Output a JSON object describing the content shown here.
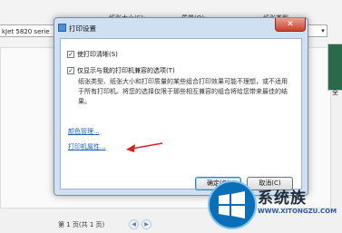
{
  "background": {
    "printer_select": "kJet 5820 serie",
    "headers": [
      "纸张大小(S):",
      "质量(Q):",
      "纸张类型"
    ],
    "page_nav_text": "第 1 页(共 1 页)",
    "thumb_label": "全"
  },
  "dialog": {
    "title": "打印设置",
    "close_symbol": "✕",
    "checkbox1_label": "使打印清晰(S)",
    "checkbox2_label": "仅显示与我的打印机兼容的选项(T)",
    "description": "纸张类型、纸张大小和打印质量的某些组合打印效果可能不理想，或不适用于所有打印机。将您的选择仅限于那些相互兼容的组合将给您带来最佳的结果。",
    "link_color_management": "颜色管理...",
    "link_printer_properties": "打印机属性...",
    "ok_button": "确定(O)",
    "cancel_button": "取消(C)"
  },
  "watermark": {
    "brand": "系统族",
    "url": "WWW.XITONGZU.COM"
  },
  "colors": {
    "dialog_frame": "#cfe0f3",
    "link": "#1e5fc0",
    "arrow": "#e02020",
    "close_button": "#c8402e"
  }
}
